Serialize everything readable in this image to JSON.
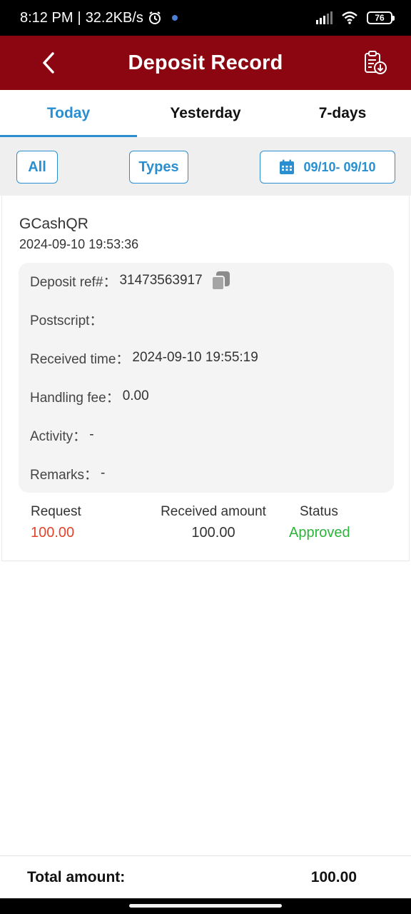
{
  "status_bar": {
    "time": "8:12 PM",
    "separator": "|",
    "speed": "32.2KB/s",
    "battery": "76"
  },
  "header": {
    "title": "Deposit Record",
    "accent_color": "#8b0610"
  },
  "tabs": [
    {
      "label": "Today",
      "active": true
    },
    {
      "label": "Yesterday",
      "active": false
    },
    {
      "label": "7-days",
      "active": false
    }
  ],
  "filters": {
    "all_label": "All",
    "types_label": "Types",
    "date_range": "09/10- 09/10"
  },
  "record": {
    "method": "GCashQR",
    "time": "2024-09-10 19:53:36",
    "details": [
      {
        "label": "Deposit ref#：",
        "value": "31473563917"
      },
      {
        "label": "Postscript：",
        "value": ""
      },
      {
        "label": "Received time：",
        "value": "2024-09-10 19:55:19"
      },
      {
        "label": "Handling fee：",
        "value": "0.00"
      },
      {
        "label": "Activity：",
        "value": "-"
      },
      {
        "label": "Remarks：",
        "value": "-"
      }
    ],
    "summary": {
      "request_label": "Request",
      "request_value": "100.00",
      "received_label": "Received amount",
      "received_value": "100.00",
      "status_label": "Status",
      "status_value": "Approved"
    }
  },
  "footer": {
    "total_label": "Total amount:",
    "total_value": "100.00"
  },
  "colors": {
    "tab_active": "#2a8fd0",
    "request_red": "#e0452c",
    "approved_green": "#2db33b"
  }
}
